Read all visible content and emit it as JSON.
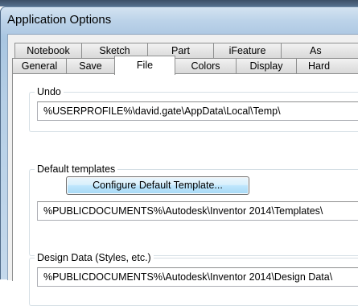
{
  "window": {
    "title": "Application Options"
  },
  "tabs": {
    "back_row": [
      {
        "label": "Notebook"
      },
      {
        "label": "Sketch"
      },
      {
        "label": "Part"
      },
      {
        "label": "iFeature"
      },
      {
        "label": "As"
      }
    ],
    "front_row": [
      {
        "label": "General"
      },
      {
        "label": "Save"
      },
      {
        "label": "File",
        "active": true
      },
      {
        "label": "Colors"
      },
      {
        "label": "Display"
      },
      {
        "label": "Hard"
      }
    ]
  },
  "file_tab": {
    "undo": {
      "label": "Undo",
      "path": "%USERPROFILE%\\david.gate\\AppData\\Local\\Temp\\"
    },
    "default_templates": {
      "label": "Default templates",
      "button_label": "Configure Default Template...",
      "path": "%PUBLICDOCUMENTS%\\Autodesk\\Inventor 2014\\Templates\\"
    },
    "design_data": {
      "label": "Design Data (Styles, etc.)",
      "path": "%PUBLICDOCUMENTS%\\Autodesk\\Inventor 2014\\Design Data\\"
    }
  }
}
